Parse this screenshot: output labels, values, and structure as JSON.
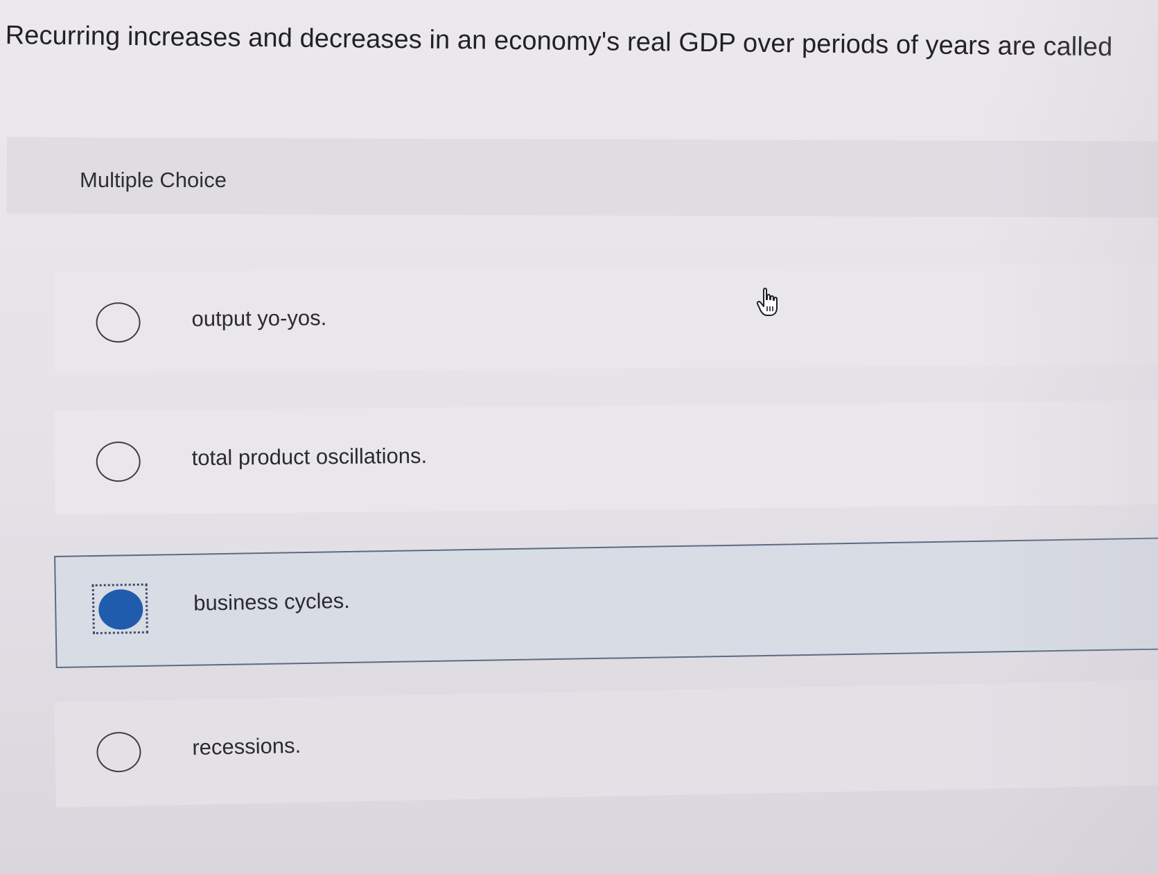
{
  "question": {
    "text": "Recurring increases and decreases in an economy's real GDP over periods of years are called"
  },
  "question_type": {
    "label": "Multiple Choice"
  },
  "options": [
    {
      "label": "output yo-yos.",
      "selected": false
    },
    {
      "label": "total product oscillations.",
      "selected": false
    },
    {
      "label": "business cycles.",
      "selected": true
    },
    {
      "label": "recessions.",
      "selected": false
    }
  ],
  "colors": {
    "selected_radio": "#1f5cae",
    "selected_option_border": "#5b6b82",
    "background": "#ebe9ec"
  },
  "icons": {
    "pointer": "hand-pointer-icon"
  }
}
